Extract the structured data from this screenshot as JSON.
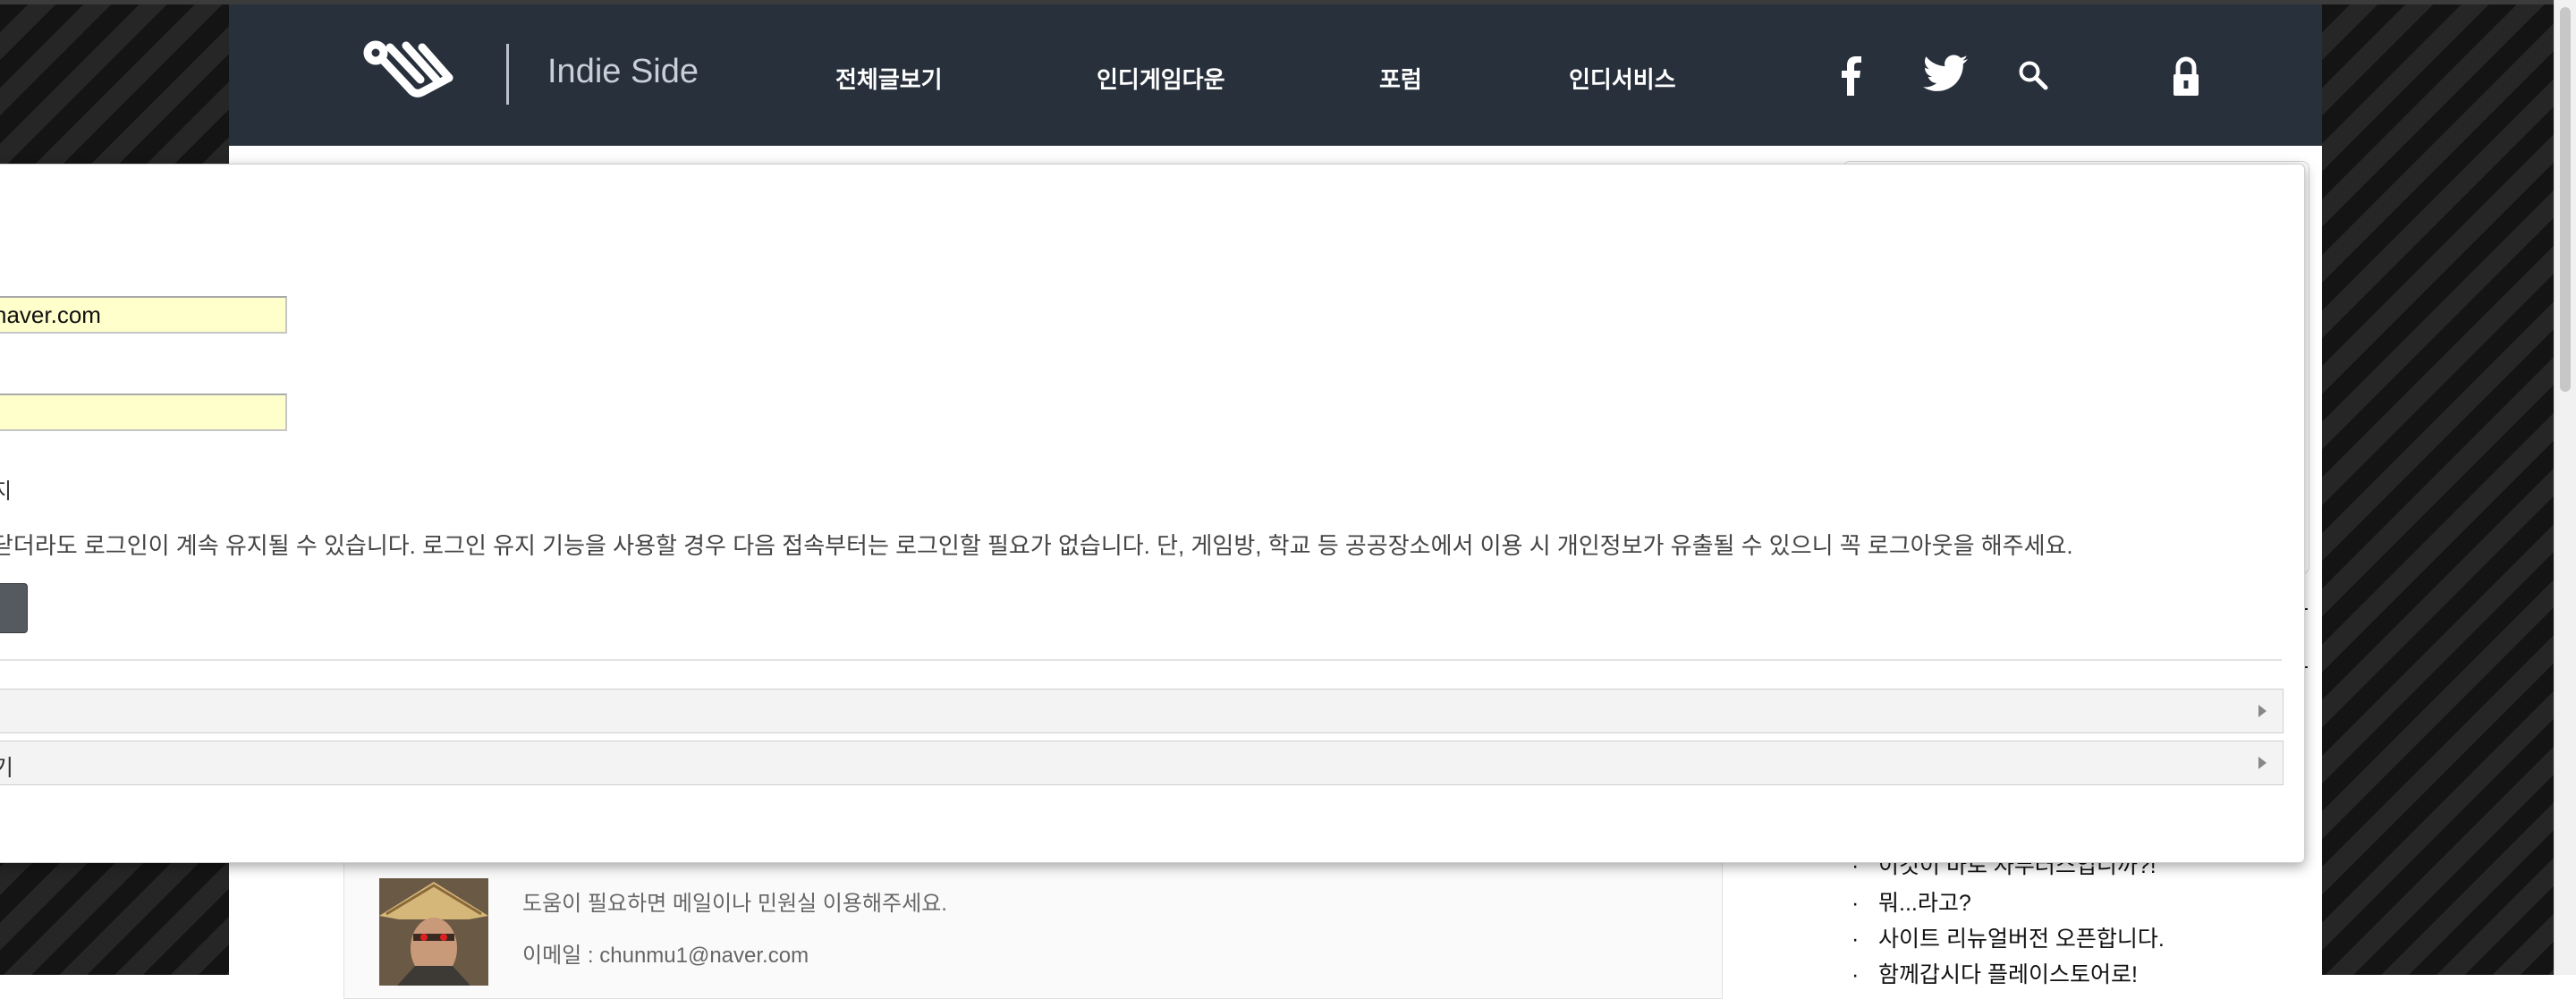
{
  "site": {
    "brand": "Indie Side",
    "nav": [
      {
        "label": "전체글보기"
      },
      {
        "label": "인디게임다운"
      },
      {
        "label": "포럼"
      },
      {
        "label": "인디서비스"
      }
    ],
    "icons": [
      "facebook-icon",
      "twitter-icon",
      "search-icon",
      "lock-icon"
    ],
    "colors": {
      "header": "#28303c",
      "field_autofill": "#ffffcc"
    }
  },
  "login_modal": {
    "email_value": "naver.com",
    "password_value": "",
    "keep_login_label": "지",
    "keep_login_notice": "닫더라도 로그인이 계속 유지될 수 있습니다. 로그인 유지 기능을 사용할 경우 다음 접속부터는 로그인할 필요가 없습니다. 단, 게임방, 학교 등 공공장소에서 이용 시 개인정보가 유출될 수 있으니 꼭 로그아웃을 해주세요.",
    "accordion": [
      {
        "label": ""
      },
      {
        "label": "기"
      }
    ]
  },
  "profile": {
    "help_text": "도움이 필요하면 메일이나 민원실 이용해주세요.",
    "email_text": "이메일 : chunmu1@naver.com"
  },
  "latest_posts": [
    {
      "title": "이것이 바로 자부러스입니까?!"
    },
    {
      "title": "뭐...라고?"
    },
    {
      "title": "사이트 리뉴얼버전 오픈합니다."
    },
    {
      "title": "함께갑시다 플레이스토어로!"
    }
  ]
}
